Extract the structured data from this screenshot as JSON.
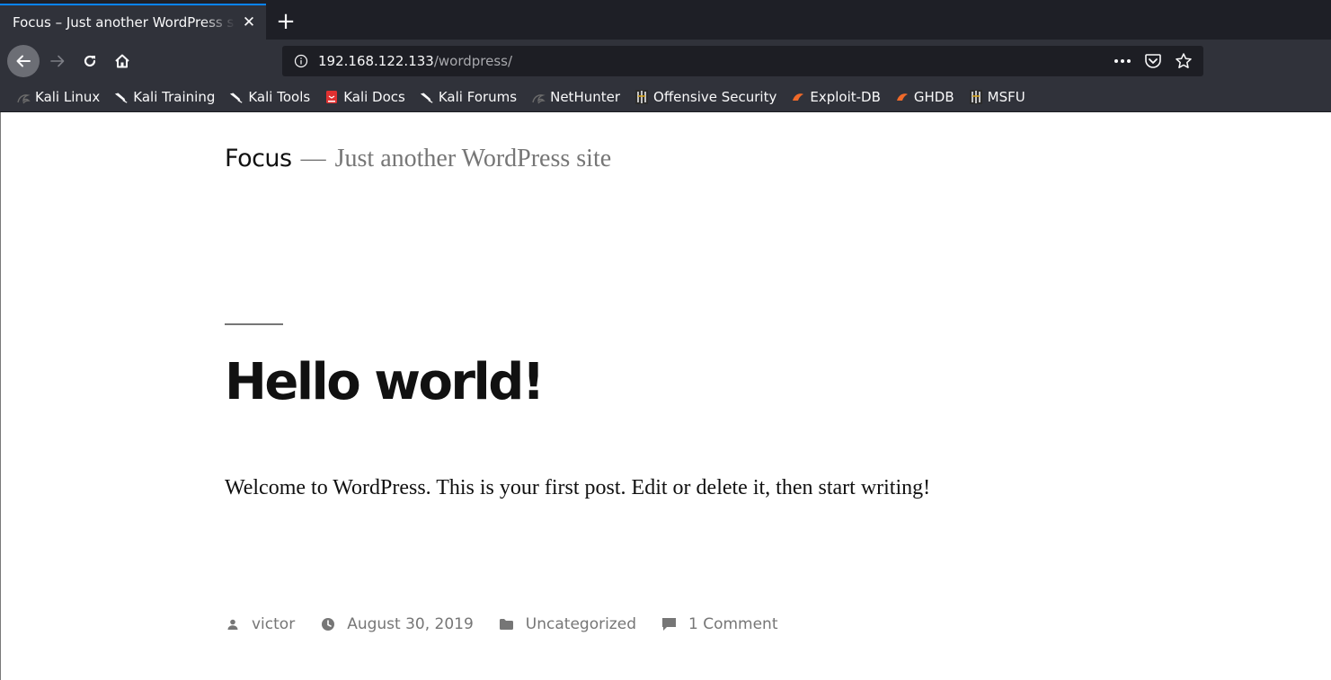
{
  "browser": {
    "tab": {
      "title": "Focus – Just another WordPress site",
      "close_glyph": "✕"
    },
    "new_tab_glyph": "+",
    "url": {
      "host": "192.168.122.133",
      "path": "/wordpress/"
    },
    "url_actions": [
      "page-actions-icon",
      "pocket-icon",
      "bookmark-star-icon"
    ],
    "bookmarks": [
      {
        "label": "Kali Linux",
        "icon": "kali-dragon-icon"
      },
      {
        "label": "Kali Training",
        "icon": "kali-dragon-icon"
      },
      {
        "label": "Kali Tools",
        "icon": "kali-dragon-icon"
      },
      {
        "label": "Kali Docs",
        "icon": "kali-docs-icon"
      },
      {
        "label": "Kali Forums",
        "icon": "kali-dragon-icon"
      },
      {
        "label": "NetHunter",
        "icon": "nethunter-icon"
      },
      {
        "label": "Offensive Security",
        "icon": "offsec-icon"
      },
      {
        "label": "Exploit-DB",
        "icon": "exploit-db-icon"
      },
      {
        "label": "GHDB",
        "icon": "ghdb-icon"
      },
      {
        "label": "MSFU",
        "icon": "offsec-icon"
      }
    ],
    "colors": {
      "chrome_dark": "#1e1f26",
      "toolbar": "#30323a",
      "tab_accent": "#0a84ff",
      "urlbar_bg": "#1d1e24"
    }
  },
  "site": {
    "title": "Focus",
    "separator": "—",
    "description": "Just another WordPress site"
  },
  "post": {
    "title": "Hello world!",
    "content": "Welcome to WordPress. This is your first post. Edit or delete it, then start writing!",
    "meta": {
      "author": "victor",
      "date": "August 30, 2019",
      "category": "Uncategorized",
      "comments": "1 Comment"
    }
  }
}
